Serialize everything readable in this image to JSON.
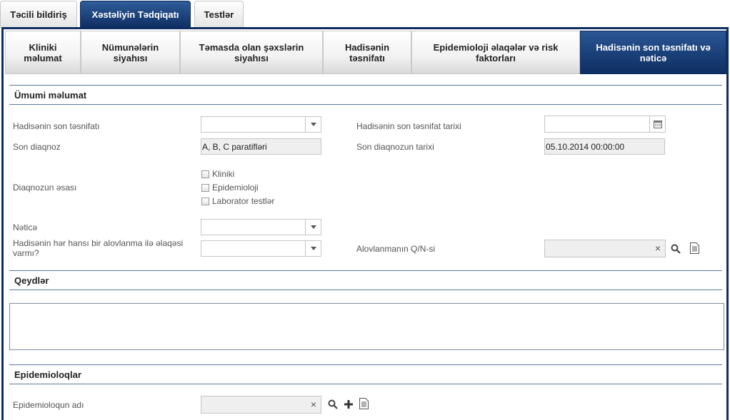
{
  "top_tabs": [
    {
      "label": "Təcili bildiriş",
      "active": false
    },
    {
      "label": "Xəstəliyin Tədqiqatı",
      "active": true
    },
    {
      "label": "Testlər",
      "active": false
    }
  ],
  "sub_tabs": [
    {
      "label": "Kliniki məlumat"
    },
    {
      "label": "Nümunələrin siyahısı"
    },
    {
      "label": "Təmasda olan şəxslərin siyahısı"
    },
    {
      "label": "Hadisənin təsnifatı"
    },
    {
      "label": "Epidemioloji əlaqələr və risk faktorları"
    },
    {
      "label": "Hadisənin son təsnifatı və nəticə"
    }
  ],
  "general": {
    "title": "Ümumi məlumat",
    "final_classification_label": "Hadisənin son təsnifatı",
    "final_classification_value": "",
    "final_classification_date_label": "Hadisənin son təsnifat tarixi",
    "final_classification_date_value": "",
    "final_diagnosis_label": "Son diaqnoz",
    "final_diagnosis_value": "A, B, C paratifləri",
    "final_diagnosis_date_label": "Son diaqnozun tarixi",
    "final_diagnosis_date_value": "05.10.2014 00:00:00",
    "diagnosis_basis_label": "Diaqnozun əsası",
    "basis_options": [
      "Kliniki",
      "Epidemioloji",
      "Laborator testlər"
    ],
    "outcome_label": "Nəticə",
    "outcome_value": "",
    "outbreak_link_label": "Hadisənin hər hansı bir alovlanma ilə əlaqəsi varmı?",
    "outbreak_link_value": "",
    "outbreak_id_label": "Alovlanmanın Q/N-si",
    "outbreak_id_value": ""
  },
  "notes": {
    "title": "Qeydlər",
    "value": ""
  },
  "epidemiologists": {
    "title": "Epidemioloqlar",
    "name_label": "Epidemioloqun adı",
    "name_value": ""
  },
  "icons": {
    "clear": "×",
    "search": "search-icon",
    "add": "plus-icon",
    "document": "document-icon",
    "calendar": "calendar-icon"
  }
}
